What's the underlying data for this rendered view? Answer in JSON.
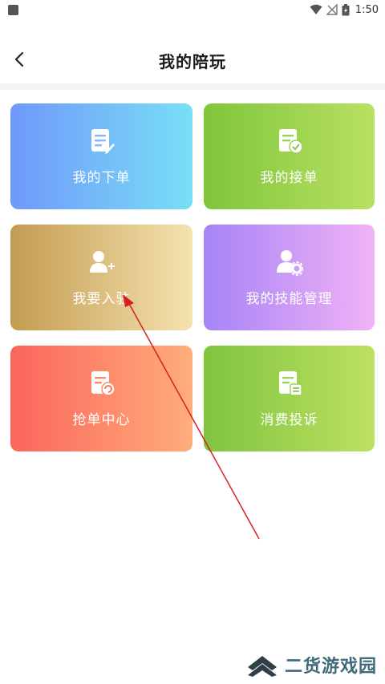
{
  "status_bar": {
    "time": "1:50"
  },
  "header": {
    "title": "我的陪玩"
  },
  "menu": {
    "items": [
      {
        "label": "我的下单",
        "icon": "order-list-icon"
      },
      {
        "label": "我的接单",
        "icon": "accept-order-icon"
      },
      {
        "label": "我要入驻",
        "icon": "add-user-icon"
      },
      {
        "label": "我的技能管理",
        "icon": "user-settings-icon"
      },
      {
        "label": "抢单中心",
        "icon": "grab-order-icon"
      },
      {
        "label": "消费投诉",
        "icon": "complaint-icon"
      }
    ]
  },
  "watermark": {
    "text": "二货游戏园"
  },
  "colors": {
    "card1": [
      "#6f98fb",
      "#79dff6"
    ],
    "card2": [
      "#7fc63b",
      "#b9e062"
    ],
    "card3": [
      "#c39b50",
      "#f4e2af"
    ],
    "card4": [
      "#a684f7",
      "#f1b2f5"
    ],
    "card5": [
      "#fb655b",
      "#ffad7b"
    ],
    "card6": [
      "#80c43f",
      "#bde161"
    ],
    "annotation_arrow": "#d62020"
  }
}
